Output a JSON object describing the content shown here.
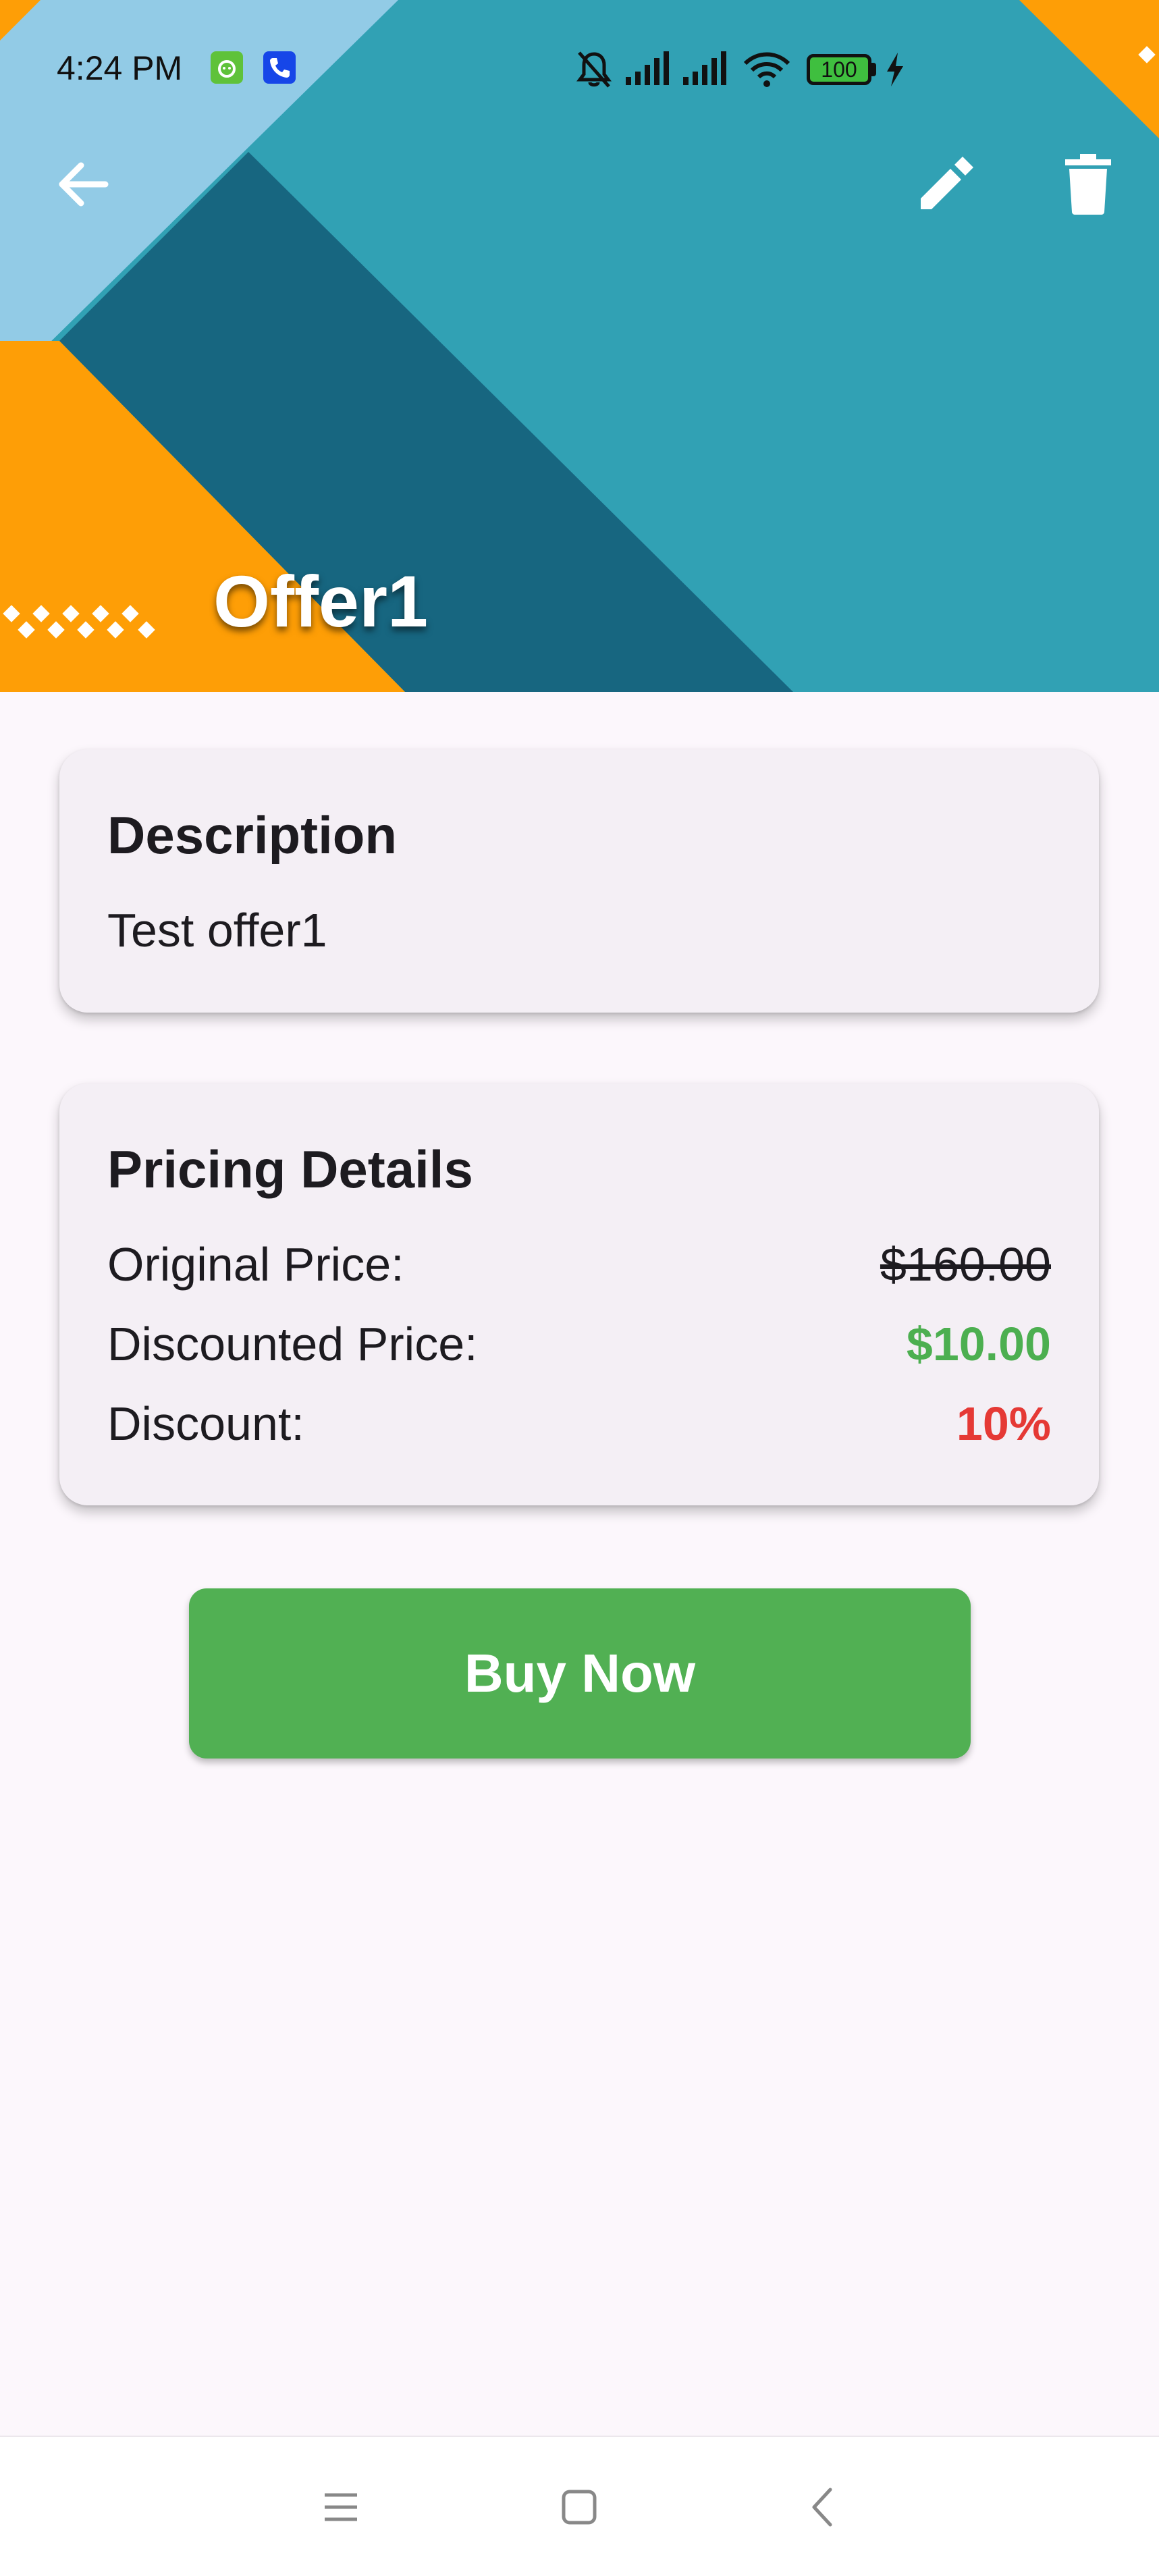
{
  "status_bar": {
    "time": "4:24 PM",
    "battery_level": "100",
    "icons": [
      "app-notification-icon",
      "phone-app-icon",
      "bell-muted-icon",
      "signal-icon",
      "signal-icon",
      "wifi-icon",
      "battery-icon",
      "charging-icon"
    ]
  },
  "header": {
    "title": "Offer1",
    "back_icon": "arrow-back-icon",
    "edit_icon": "pencil-icon",
    "delete_icon": "trash-icon",
    "colors": {
      "teal": "#31a1b4",
      "dark_teal": "#176680",
      "light_blue": "#92cbe6",
      "orange": "#fe9e06"
    }
  },
  "description_card": {
    "title": "Description",
    "text": "Test offer1"
  },
  "pricing_card": {
    "title": "Pricing Details",
    "rows": [
      {
        "label": "Original Price:",
        "value": "$160.00"
      },
      {
        "label": "Discounted Price:",
        "value": "$10.00"
      },
      {
        "label": "Discount:",
        "value": "10%"
      }
    ],
    "colors": {
      "discounted": "#4caf50",
      "discount": "#e53935"
    }
  },
  "buy_button": {
    "label": "Buy Now",
    "color": "#51b053"
  },
  "nav_bar": {
    "icons": [
      "menu-icon",
      "home-icon",
      "back-chevron-icon"
    ]
  }
}
